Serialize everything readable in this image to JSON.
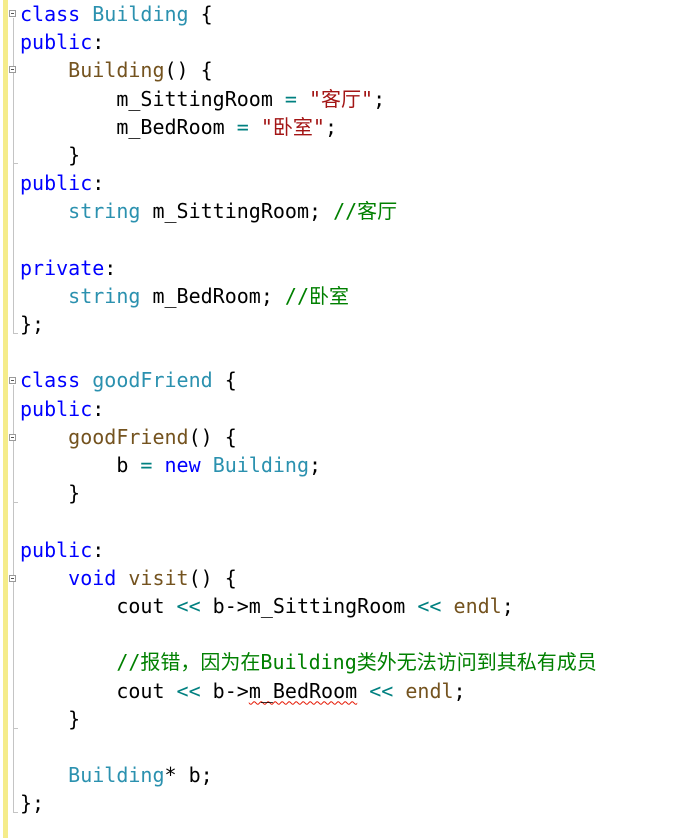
{
  "editor": {
    "lines": [
      [
        {
          "t": "class",
          "c": "kw"
        },
        {
          "t": " "
        },
        {
          "t": "Building",
          "c": "type"
        },
        {
          "t": " {"
        }
      ],
      [
        {
          "t": "public",
          "c": "kw"
        },
        {
          "t": ":"
        }
      ],
      [
        {
          "t": "    "
        },
        {
          "t": "Building",
          "c": "fn"
        },
        {
          "t": "() {"
        }
      ],
      [
        {
          "t": "        m_SittingRoom "
        },
        {
          "t": "=",
          "c": "op"
        },
        {
          "t": " "
        },
        {
          "t": "\"客厅\"",
          "c": "str"
        },
        {
          "t": ";"
        }
      ],
      [
        {
          "t": "        m_BedRoom "
        },
        {
          "t": "=",
          "c": "op"
        },
        {
          "t": " "
        },
        {
          "t": "\"卧室\"",
          "c": "str"
        },
        {
          "t": ";"
        }
      ],
      [
        {
          "t": "    }"
        }
      ],
      [
        {
          "t": "public",
          "c": "kw"
        },
        {
          "t": ":"
        }
      ],
      [
        {
          "t": "    "
        },
        {
          "t": "string",
          "c": "type"
        },
        {
          "t": " m_SittingRoom; "
        },
        {
          "t": "//客厅",
          "c": "cmt"
        }
      ],
      [],
      [
        {
          "t": "private",
          "c": "kw"
        },
        {
          "t": ":"
        }
      ],
      [
        {
          "t": "    "
        },
        {
          "t": "string",
          "c": "type"
        },
        {
          "t": " m_BedRoom; "
        },
        {
          "t": "//卧室",
          "c": "cmt"
        }
      ],
      [
        {
          "t": "};"
        }
      ],
      [],
      [
        {
          "t": "class",
          "c": "kw"
        },
        {
          "t": " "
        },
        {
          "t": "goodFriend",
          "c": "type"
        },
        {
          "t": " {"
        }
      ],
      [
        {
          "t": "public",
          "c": "kw"
        },
        {
          "t": ":"
        }
      ],
      [
        {
          "t": "    "
        },
        {
          "t": "goodFriend",
          "c": "fn"
        },
        {
          "t": "() {"
        }
      ],
      [
        {
          "t": "        b "
        },
        {
          "t": "=",
          "c": "op"
        },
        {
          "t": " "
        },
        {
          "t": "new",
          "c": "kw"
        },
        {
          "t": " "
        },
        {
          "t": "Building",
          "c": "type"
        },
        {
          "t": ";"
        }
      ],
      [
        {
          "t": "    }"
        }
      ],
      [],
      [
        {
          "t": "public",
          "c": "kw"
        },
        {
          "t": ":"
        }
      ],
      [
        {
          "t": "    "
        },
        {
          "t": "void",
          "c": "kw"
        },
        {
          "t": " "
        },
        {
          "t": "visit",
          "c": "fn"
        },
        {
          "t": "() {"
        }
      ],
      [
        {
          "t": "        cout "
        },
        {
          "t": "<<",
          "c": "op"
        },
        {
          "t": " b->m_SittingRoom "
        },
        {
          "t": "<<",
          "c": "op"
        },
        {
          "t": " "
        },
        {
          "t": "endl",
          "c": "fn"
        },
        {
          "t": ";"
        }
      ],
      [],
      [
        {
          "t": "        "
        },
        {
          "t": "//报错，因为在Building类外无法访问到其私有成员",
          "c": "cmt"
        }
      ],
      [
        {
          "t": "        cout "
        },
        {
          "t": "<<",
          "c": "op"
        },
        {
          "t": " b->"
        },
        {
          "t": "m_BedRoom",
          "c": "squiggle"
        },
        {
          "t": " "
        },
        {
          "t": "<<",
          "c": "op"
        },
        {
          "t": " "
        },
        {
          "t": "endl",
          "c": "fn"
        },
        {
          "t": ";"
        }
      ],
      [
        {
          "t": "    }"
        }
      ],
      [],
      [
        {
          "t": "    "
        },
        {
          "t": "Building",
          "c": "type"
        },
        {
          "t": "* b;"
        }
      ],
      [
        {
          "t": "};"
        }
      ]
    ]
  }
}
